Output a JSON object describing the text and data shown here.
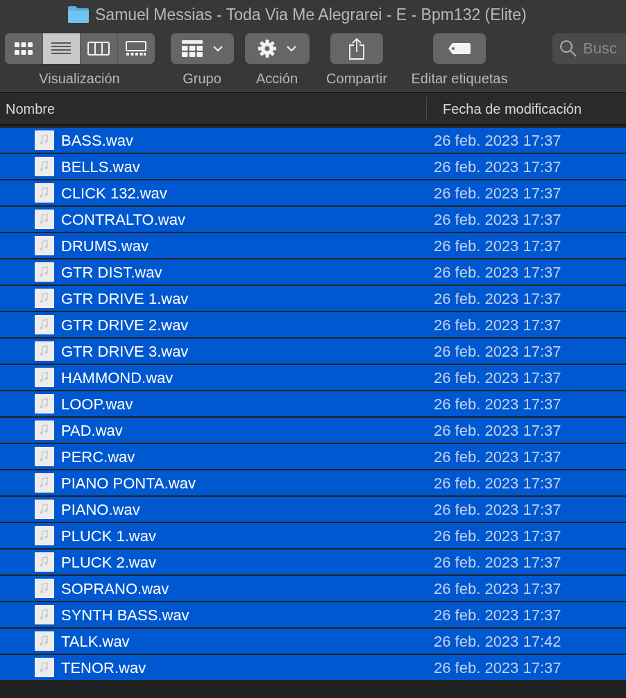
{
  "window": {
    "title": "Samuel Messias - Toda Via Me Alegrarei - E - Bpm132 (Elite)"
  },
  "toolbar": {
    "view": {
      "label": "Visualización",
      "buttons": [
        {
          "kind": "icons",
          "selected": false
        },
        {
          "kind": "list",
          "selected": true
        },
        {
          "kind": "columns",
          "selected": false
        },
        {
          "kind": "gallery",
          "selected": false
        }
      ]
    },
    "items": [
      {
        "kind": "group",
        "label": "Grupo"
      },
      {
        "kind": "action",
        "label": "Acción"
      },
      {
        "kind": "share",
        "label": "Compartir"
      },
      {
        "kind": "tags",
        "label": "Editar etiquetas"
      }
    ],
    "search": {
      "placeholder": "Busc"
    }
  },
  "table": {
    "columns": [
      "Nombre",
      "Fecha de modificación"
    ],
    "rows": [
      {
        "name": "BASS.wav",
        "modified": "26 feb. 2023 17:37",
        "selected": true
      },
      {
        "name": "BELLS.wav",
        "modified": "26 feb. 2023 17:37",
        "selected": true
      },
      {
        "name": "CLICK 132.wav",
        "modified": "26 feb. 2023 17:37",
        "selected": true
      },
      {
        "name": "CONTRALTO.wav",
        "modified": "26 feb. 2023 17:37",
        "selected": true
      },
      {
        "name": "DRUMS.wav",
        "modified": "26 feb. 2023 17:37",
        "selected": true
      },
      {
        "name": "GTR DIST.wav",
        "modified": "26 feb. 2023 17:37",
        "selected": true
      },
      {
        "name": "GTR DRIVE 1.wav",
        "modified": "26 feb. 2023 17:37",
        "selected": true
      },
      {
        "name": "GTR DRIVE 2.wav",
        "modified": "26 feb. 2023 17:37",
        "selected": true
      },
      {
        "name": "GTR DRIVE 3.wav",
        "modified": "26 feb. 2023 17:37",
        "selected": true
      },
      {
        "name": "HAMMOND.wav",
        "modified": "26 feb. 2023 17:37",
        "selected": true
      },
      {
        "name": "LOOP.wav",
        "modified": "26 feb. 2023 17:37",
        "selected": true
      },
      {
        "name": "PAD.wav",
        "modified": "26 feb. 2023 17:37",
        "selected": true
      },
      {
        "name": "PERC.wav",
        "modified": "26 feb. 2023 17:37",
        "selected": true
      },
      {
        "name": "PIANO PONTA.wav",
        "modified": "26 feb. 2023 17:37",
        "selected": true
      },
      {
        "name": "PIANO.wav",
        "modified": "26 feb. 2023 17:37",
        "selected": true
      },
      {
        "name": "PLUCK 1.wav",
        "modified": "26 feb. 2023 17:37",
        "selected": true
      },
      {
        "name": "PLUCK 2.wav",
        "modified": "26 feb. 2023 17:37",
        "selected": true
      },
      {
        "name": "SOPRANO.wav",
        "modified": "26 feb. 2023 17:37",
        "selected": true
      },
      {
        "name": "SYNTH BASS.wav",
        "modified": "26 feb. 2023 17:37",
        "selected": true
      },
      {
        "name": "TALK.wav",
        "modified": "26 feb. 2023 17:42",
        "selected": true
      },
      {
        "name": "TENOR.wav",
        "modified": "26 feb. 2023 17:37",
        "selected": true
      }
    ]
  }
}
